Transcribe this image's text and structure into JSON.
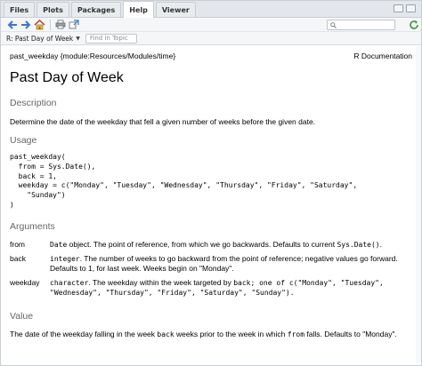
{
  "tabs": [
    {
      "label": "Files",
      "active": false
    },
    {
      "label": "Plots",
      "active": false
    },
    {
      "label": "Packages",
      "active": false
    },
    {
      "label": "Help",
      "active": true
    },
    {
      "label": "Viewer",
      "active": false
    }
  ],
  "toolbar": {
    "search_placeholder": "",
    "topic_label": "R: Past Day of Week",
    "find_placeholder": "Find in Topic"
  },
  "doc": {
    "header_left": "past_weekday {module:Resources/Modules/time}",
    "header_right": "R Documentation",
    "title": "Past Day of Week",
    "description_heading": "Description",
    "description_text": "Determine the date of the weekday that fell a given number of weeks before the given date.",
    "usage_heading": "Usage",
    "usage_code": "past_weekday(\n  from = Sys.Date(),\n  back = 1,\n  weekday = c(\"Monday\", \"Tuesday\", \"Wednesday\", \"Thursday\", \"Friday\", \"Saturday\",\n    \"Sunday\")\n)",
    "arguments_heading": "Arguments",
    "arguments": [
      {
        "name": "from",
        "code": "Date",
        "desc": " object. The point of reference, from which we go backwards. Defaults to current ",
        "code2": "Sys.Date()",
        "desc2": "."
      },
      {
        "name": "back",
        "code": "integer",
        "desc": ". The number of weeks to go backward from the point of reference; negative values go forward. Defaults to 1, for last week. Weeks begin on \"Monday\".",
        "code2": "",
        "desc2": ""
      },
      {
        "name": "weekday",
        "code": "character",
        "desc": ". The weekday within the week targeted by ",
        "code2": "back",
        "desc2": "; one of c(\"Monday\", \"Tuesday\", \"Wednesday\", \"Thursday\", \"Friday\", \"Saturday\", \"Sunday\")."
      }
    ],
    "value_heading": "Value",
    "value_text_1": "The date of the weekday falling in the week ",
    "value_code_1": "back",
    "value_text_2": " weeks prior to the week in which ",
    "value_code_2": "from",
    "value_text_3": " falls. Defaults to \"Monday\"."
  }
}
